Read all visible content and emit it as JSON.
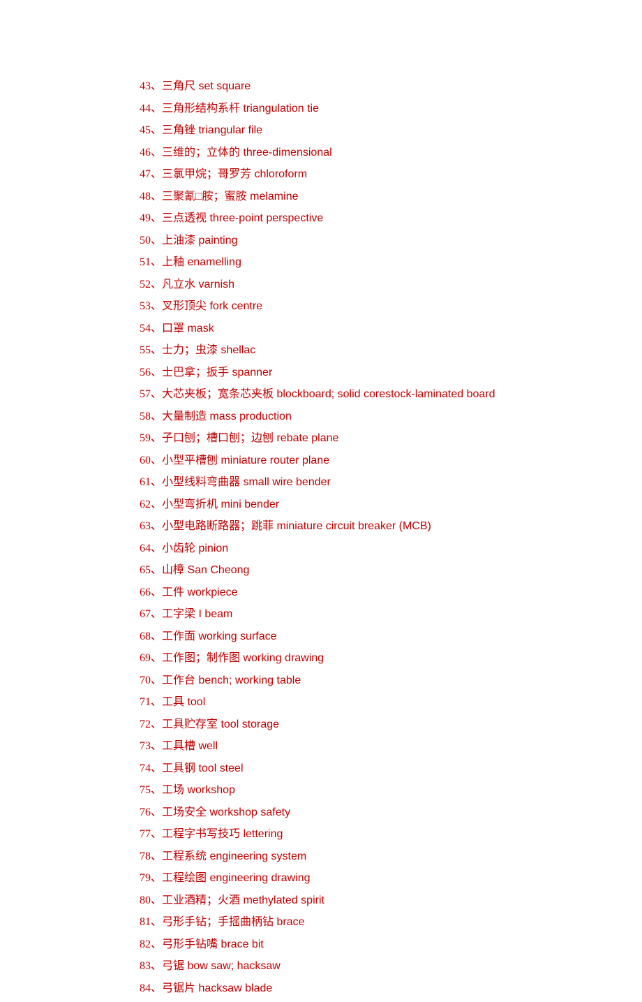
{
  "items": [
    {
      "num": "43",
      "text": "三角尺 set square"
    },
    {
      "num": "44",
      "text": "三角形结构系杆 triangulation tie"
    },
    {
      "num": "45",
      "text": "三角锉 triangular file"
    },
    {
      "num": "46",
      "text": "三维的；立体的 three-dimensional"
    },
    {
      "num": "47",
      "text": "三氯甲烷；哥罗芳 chloroform"
    },
    {
      "num": "48",
      "text": "三聚氰□胺；蜜胺 melamine"
    },
    {
      "num": "49",
      "text": "三点透视 three-point perspective"
    },
    {
      "num": "50",
      "text": "上油漆 painting"
    },
    {
      "num": "51",
      "text": "上釉 enamelling"
    },
    {
      "num": "52",
      "text": "凡立水 varnish"
    },
    {
      "num": "53",
      "text": "叉形顶尖 fork centre"
    },
    {
      "num": "54",
      "text": "口罩 mask"
    },
    {
      "num": "55",
      "text": "士力；虫漆 shellac"
    },
    {
      "num": "56",
      "text": "士巴拿；扳手 spanner"
    },
    {
      "num": "57",
      "text": "大芯夹板；宽条芯夹板 blockboard; solid corestock-laminated board"
    },
    {
      "num": "58",
      "text": "大量制造 mass production"
    },
    {
      "num": "59",
      "text": "子口刨；槽口刨；边刨 rebate plane"
    },
    {
      "num": "60",
      "text": "小型平槽刨 miniature router plane"
    },
    {
      "num": "61",
      "text": "小型线料弯曲器 small wire bender"
    },
    {
      "num": "62",
      "text": "小型弯折机 mini bender"
    },
    {
      "num": "63",
      "text": "小型电路断路器；跳菲 miniature circuit breaker (MCB)"
    },
    {
      "num": "64",
      "text": "小齿轮 pinion"
    },
    {
      "num": "65",
      "text": "山樟 San Cheong"
    },
    {
      "num": "66",
      "text": "工件 workpiece"
    },
    {
      "num": "67",
      "text": "工字梁 I beam"
    },
    {
      "num": "68",
      "text": "工作面 working surface"
    },
    {
      "num": "69",
      "text": "工作图；制作图 working drawing"
    },
    {
      "num": "70",
      "text": "工作台 bench; working table"
    },
    {
      "num": "71",
      "text": "工具 tool"
    },
    {
      "num": "72",
      "text": "工具贮存室 tool storage"
    },
    {
      "num": "73",
      "text": "工具槽 well"
    },
    {
      "num": "74",
      "text": "工具钢 tool steel"
    },
    {
      "num": "75",
      "text": "工场 workshop"
    },
    {
      "num": "76",
      "text": "工场安全 workshop safety"
    },
    {
      "num": "77",
      "text": "工程字书写技巧 lettering"
    },
    {
      "num": "78",
      "text": "工程系统 engineering system"
    },
    {
      "num": "79",
      "text": "工程绘图 engineering drawing"
    },
    {
      "num": "80",
      "text": "工业酒精；火酒 methylated spirit"
    },
    {
      "num": "81",
      "text": "弓形手钻；手摇曲柄钻 brace"
    },
    {
      "num": "82",
      "text": "弓形手钻嘴 brace bit"
    },
    {
      "num": "83",
      "text": "弓锯 bow saw; hacksaw"
    },
    {
      "num": "84",
      "text": "弓锯片 hacksaw blade"
    }
  ]
}
